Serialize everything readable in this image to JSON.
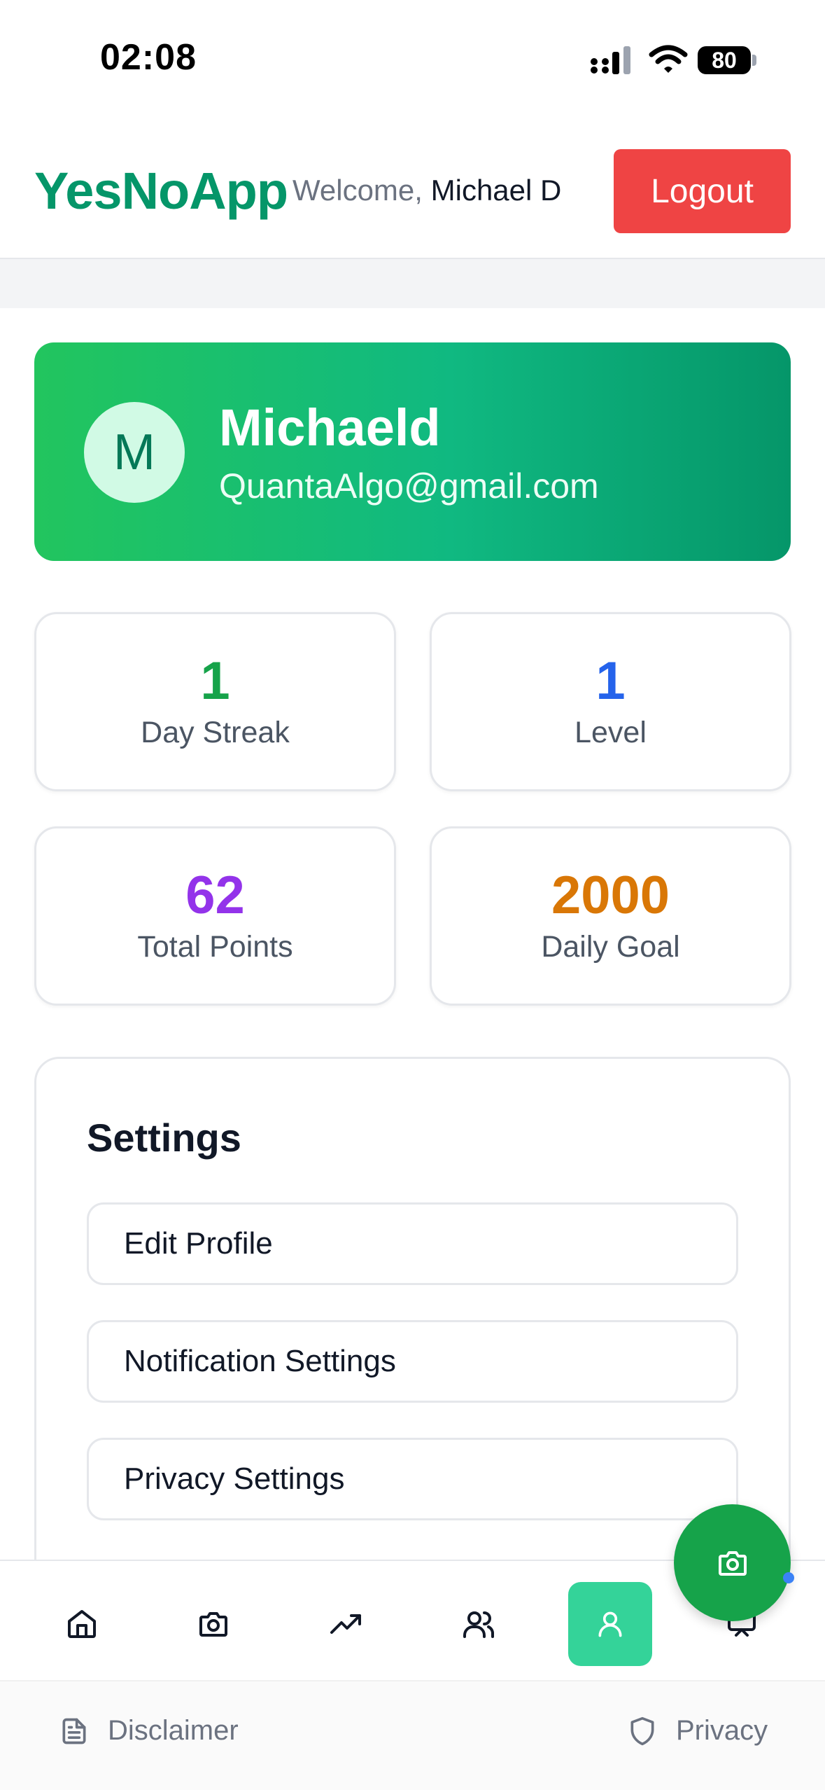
{
  "status_bar": {
    "time": "02:08",
    "battery": "80"
  },
  "header": {
    "brand": "YesNoApp",
    "welcome_prefix": "Welcome,",
    "user_name": "Michael D",
    "logout_label": "Logout"
  },
  "profile": {
    "initial": "M",
    "name": "Michaeld",
    "email": "QuantaAlgo@gmail.com"
  },
  "stats": [
    {
      "value": "1",
      "label": "Day Streak",
      "color": "#16a34a"
    },
    {
      "value": "1",
      "label": "Level",
      "color": "#2563eb"
    },
    {
      "value": "62",
      "label": "Total Points",
      "color": "#9333ea"
    },
    {
      "value": "2000",
      "label": "Daily Goal",
      "color": "#d97706"
    }
  ],
  "settings": {
    "title": "Settings",
    "items": [
      "Edit Profile",
      "Notification Settings",
      "Privacy Settings"
    ]
  },
  "bottom_nav": {
    "items": [
      {
        "icon": "home-icon"
      },
      {
        "icon": "camera-icon"
      },
      {
        "icon": "trending-up-icon"
      },
      {
        "icon": "users-icon"
      },
      {
        "icon": "user-icon",
        "active": true
      },
      {
        "icon": "chat-icon"
      }
    ]
  },
  "fab": {
    "icon": "camera-icon"
  },
  "footer": {
    "disclaimer_label": "Disclaimer",
    "privacy_label": "Privacy"
  }
}
